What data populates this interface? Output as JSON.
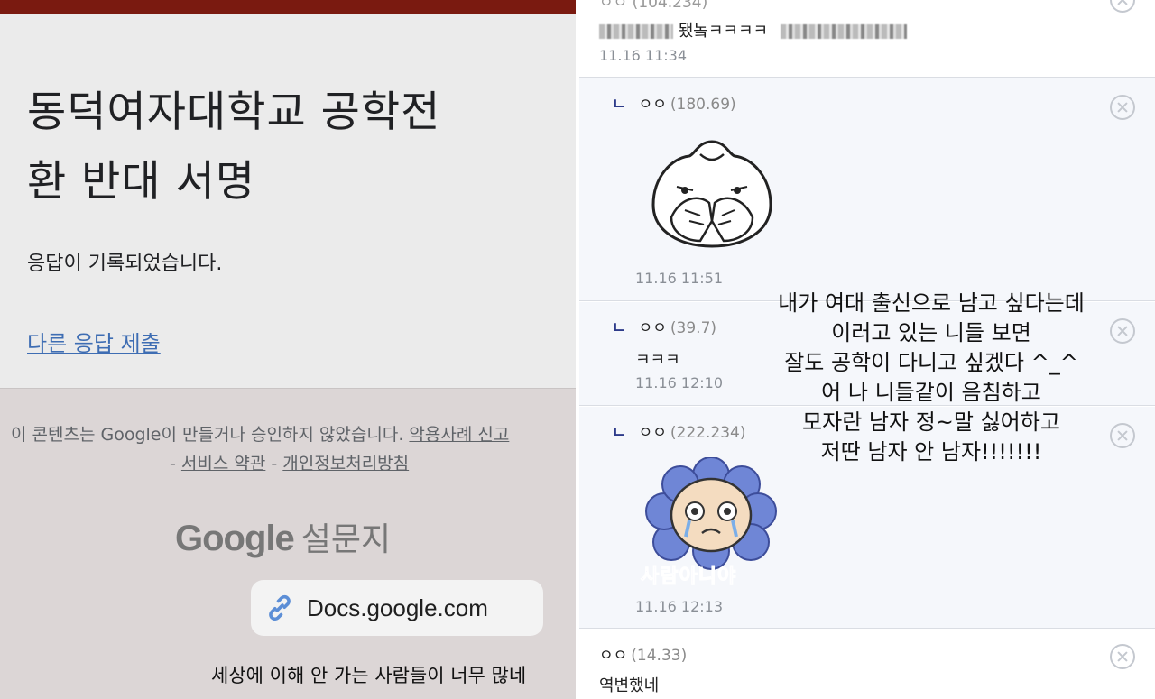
{
  "left": {
    "form_title_line1": "동덕여자대학교 공학전",
    "form_title_line2": "환 반대 서명",
    "response_message": "응답이 기록되었습니다.",
    "submit_another_link": "다른 응답 제출",
    "disclaimer_text": "이 콘텐츠는 Google이 만들거나 승인하지 않았습니다. ",
    "report_abuse_link": "악용사례 신고",
    "terms_sep1": "- ",
    "terms_link": "서비스 약관",
    "terms_sep2": " - ",
    "privacy_link": "개인정보처리방침",
    "logo_google": "Google",
    "logo_forms": "설문지",
    "url_text": "Docs.google.com",
    "caption": "세상에 이해 안 가는 사람들이 너무 많네"
  },
  "right": {
    "top_comment": {
      "head_partial": "ㅇㅇ (104.234)",
      "body_visible": "됐놐ㅋㅋㅋㅋ",
      "time": "11.16 11:34"
    },
    "reply1": {
      "arrow": "ㄴ",
      "name": "ㅇㅇ",
      "ip": "(180.69)",
      "time": "11.16 11:51",
      "sticker": "covering-mouth-bun-sticker"
    },
    "reply2": {
      "arrow": "ㄴ",
      "name": "ㅇㅇ",
      "ip": "(39.7)",
      "body": "ㅋㅋㅋ",
      "time": "11.16 12:10"
    },
    "reply3": {
      "arrow": "ㄴ",
      "name": "ㅇㅇ",
      "ip": "(222.234)",
      "time": "11.16 12:13",
      "sticker_text": "사람아니야"
    },
    "comment4": {
      "name": "ㅇㅇ",
      "ip": "(14.33)",
      "body": "역변했네"
    },
    "overlay_lines": [
      "내가 여대 출신으로 남고 싶다는데",
      "이러고 있는 니들 보면",
      "잘도 공학이 다니고 싶겠다 ^_^",
      "어 나 니들같이 음침하고",
      "모자란 남자 정~말 싫어하고",
      "저딴 남자 안 남자!!!!!!!"
    ],
    "colors": {
      "reply_bg": "#f5f7fb",
      "arrow": "#2d3b8a",
      "ip": "#8a8a8a"
    }
  }
}
